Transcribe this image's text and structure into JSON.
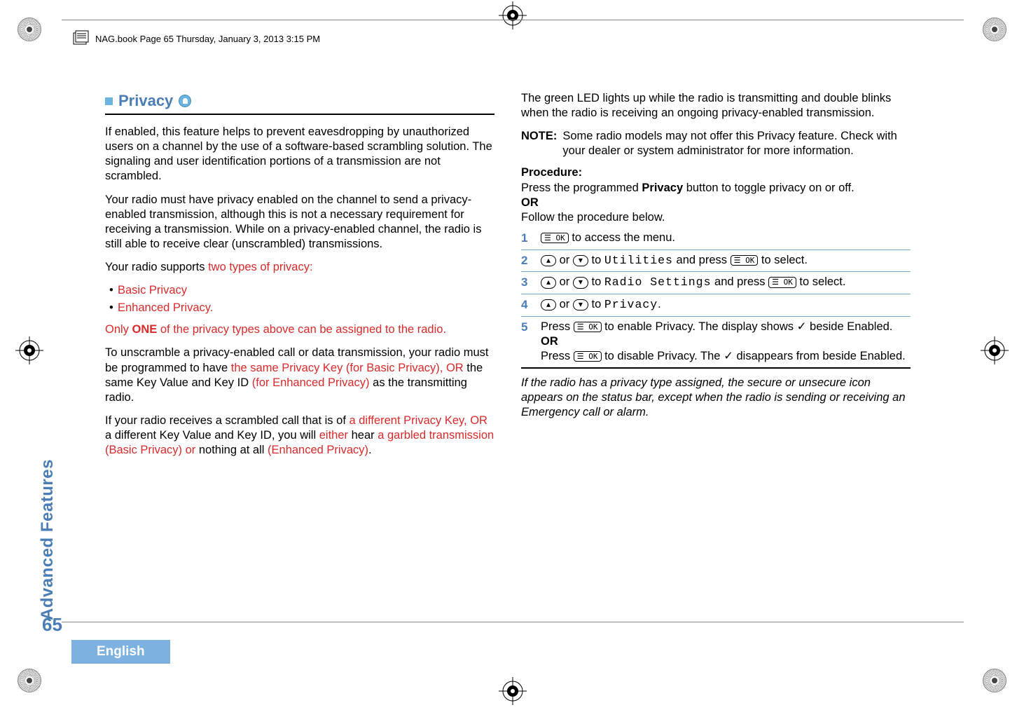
{
  "running_header": "NAG.book  Page 65  Thursday, January 3, 2013  3:15 PM",
  "section": {
    "title": "Privacy",
    "icon_name": "privacy-icon"
  },
  "left": {
    "p1": "If enabled, this feature helps to prevent eavesdropping by unauthorized users on a channel by the use of a software-based scrambling solution. The signaling and user identification portions of a transmission are not scrambled.",
    "p2": "Your radio must have privacy enabled on the channel to send a privacy-enabled transmission, although this is not a necessary requirement for receiving a transmission. While on a privacy-enabled channel, the radio is still able to receive clear (unscrambled) transmissions.",
    "p3_a": "Your radio supports ",
    "p3_b": "two types of privacy:",
    "bullets": [
      "Basic Privacy",
      "Enhanced Privacy."
    ],
    "p4_a": "Only ",
    "p4_b": "ONE",
    "p4_c": " of the privacy types above can be assigned to the radio.",
    "p5_a": "To unscramble a privacy-enabled call or data transmission, your radio must be programmed to have ",
    "p5_b": "the same Privacy Key (for Basic Privacy), OR ",
    "p5_c": "the same Key Value and Key ID ",
    "p5_d": "(for Enhanced Privacy) ",
    "p5_e": "as the transmitting radio.",
    "p6_a": "If your radio receives a scrambled call that is of ",
    "p6_b": "a different Privacy Key, OR ",
    "p6_c": "a different Key Value and Key ID, you will ",
    "p6_d": "either ",
    "p6_e": "hear ",
    "p6_f": "a garbled transmission (Basic Privacy) or ",
    "p6_g": "nothing at all ",
    "p6_h": "(Enhanced Privacy)",
    "p6_i": "."
  },
  "right": {
    "p1": "The green LED lights up while the radio is transmitting and double blinks when the radio is receiving an ongoing privacy-enabled transmission.",
    "note_label": "NOTE:",
    "note_text": "Some radio models may not offer this Privacy feature. Check with your dealer or system administrator for more information.",
    "proc_head": "Procedure:",
    "proc_a": "Press the programmed ",
    "proc_b": "Privacy",
    "proc_c": " button to toggle privacy on or off.",
    "or": "OR",
    "proc_follow": "Follow the procedure below.",
    "steps": {
      "s1": " to access the menu.",
      "s2_mid": " to ",
      "s2_menu": "Utilities",
      "s2_end": " and press ",
      "s2_fin": " to select.",
      "s3_menu": "Radio Settings",
      "s4_menu": "Privacy",
      "s5_a": "Press ",
      "s5_b": " to enable Privacy. The display shows ",
      "s5_c": " beside Enabled.",
      "s5_or": "OR",
      "s5_d": " to disable Privacy. The ",
      "s5_e": " disappears from beside Enabled."
    },
    "italic": "If the radio has a privacy type assigned, the secure or unsecure icon appears on the status bar, except when the radio is sending or receiving an Emergency call or alarm."
  },
  "keys": {
    "ok": "☰ OK",
    "up": "▴",
    "down": "▾",
    "or_word": " or ",
    "check": "✓",
    "period": "."
  },
  "side_tab": "Advanced Features",
  "page_num": "65",
  "language": "English"
}
